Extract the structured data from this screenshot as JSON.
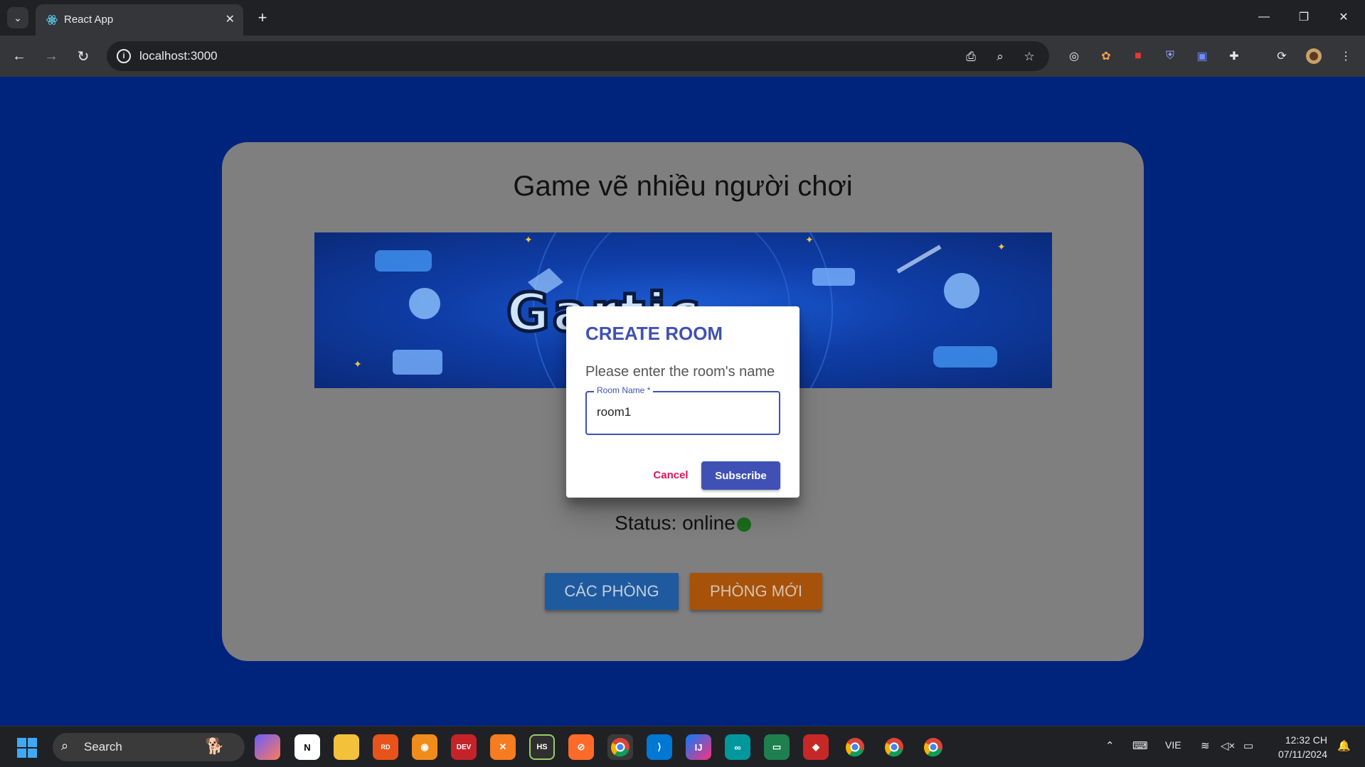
{
  "browser": {
    "tab_title": "React App",
    "url": "localhost:3000"
  },
  "page": {
    "title": "Game vẽ nhiều người chơi",
    "banner_logo": "Gartic",
    "status_label": "Status: online",
    "rooms_button": "CÁC PHÒNG",
    "new_room_button": "PHÒNG MỚI"
  },
  "dialog": {
    "title": "CREATE ROOM",
    "text": "Please enter the room's name",
    "field_label": "Room Name *",
    "field_value": "room1",
    "cancel": "Cancel",
    "subscribe": "Subscribe"
  },
  "taskbar": {
    "search_label": "Search",
    "language": "VIE",
    "time": "12:32 CH",
    "date": "07/11/2024"
  },
  "colors": {
    "page_bg": "#00237c",
    "card_bg": "#7f7f80",
    "accent": "#3f51b5",
    "cancel": "#e0105c",
    "rooms_btn": "#1f5a9f",
    "new_btn": "#a6520b",
    "status_dot": "#1b6b1b"
  }
}
